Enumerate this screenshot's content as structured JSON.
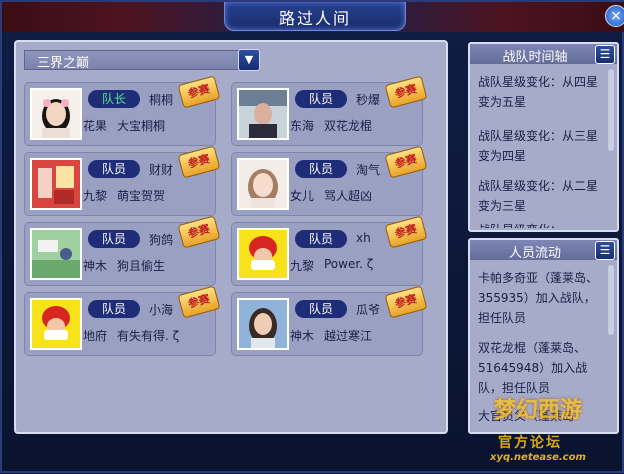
{
  "window": {
    "title": "路过人间",
    "close_glyph": "×"
  },
  "team_selector": {
    "value": "三界之巅",
    "arrow": "▼"
  },
  "members": [
    {
      "role": "队长",
      "nickname": "桐桐",
      "server": "花果",
      "name": "大宝桐桐",
      "badge": "参赛"
    },
    {
      "role": "队员",
      "nickname": "秒爆",
      "server": "东海",
      "name": "双花龙棍",
      "badge": "参赛"
    },
    {
      "role": "队员",
      "nickname": "财财",
      "server": "九黎",
      "name": "萌宝贺贺",
      "badge": "参赛"
    },
    {
      "role": "队员",
      "nickname": "淘气",
      "server": "女儿",
      "name": "骂人超凶",
      "badge": "参赛"
    },
    {
      "role": "队员",
      "nickname": "狗鸽",
      "server": "神木",
      "name": "狗且偷生",
      "badge": "参赛"
    },
    {
      "role": "队员",
      "nickname": "xh",
      "server": "九黎",
      "name": "Power. ζ",
      "badge": "参赛"
    },
    {
      "role": "队员",
      "nickname": "小海",
      "server": "地府",
      "name": "有失有得. ζ",
      "badge": "参赛"
    },
    {
      "role": "队员",
      "nickname": "瓜爷",
      "server": "神木",
      "name": "越过寒江",
      "badge": "参赛"
    }
  ],
  "timeline": {
    "title": "战队时间轴",
    "menu_glyph": "☰",
    "entries": [
      "战队星级变化：从四星变为五星",
      "战队星级变化：从三星变为四星",
      "战队星级变化：从二星变为三星",
      "战队星级变化："
    ]
  },
  "flow": {
    "title": "人员流动",
    "menu_glyph": "☰",
    "entries": [
      "卡帕多奇亚（蓬莱岛、355935）加入战队，担任队员",
      "双花龙棍（蓬莱岛、51645948）加入战队，担任队员",
      "大官员父（蓬莱岛"
    ]
  },
  "watermark": {
    "logo": "梦幻西游",
    "cn": "官方论坛",
    "url": "xyq.netease.com"
  },
  "colors": {
    "panel": "#a5abc9",
    "role_pill": "#1f2d78",
    "leader_text": "#51e48b",
    "badge": "#e8a42a"
  }
}
